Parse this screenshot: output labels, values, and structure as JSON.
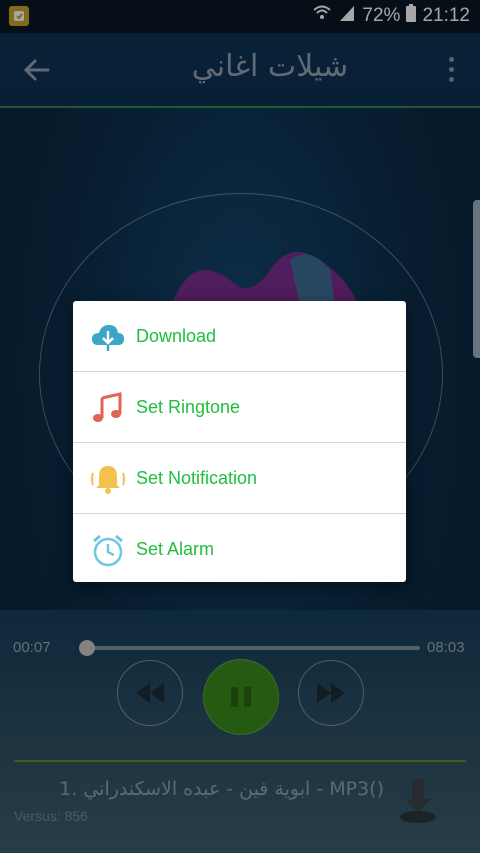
{
  "status_bar": {
    "battery": "72%",
    "time": "21:12"
  },
  "app_bar": {
    "title": "شيلات اغاني"
  },
  "player": {
    "elapsed": "00:07",
    "duration": "08:03",
    "progress": 0.015,
    "song_title": "1. ابوية فين - عبده الاسكندراني - MP3()",
    "version": "Versus: 856"
  },
  "dialog": {
    "items": [
      {
        "label": "Download",
        "icon": "cloud-download-icon"
      },
      {
        "label": "Set Ringtone",
        "icon": "music-note-icon"
      },
      {
        "label": "Set Notification",
        "icon": "bell-icon"
      },
      {
        "label": "Set Alarm",
        "icon": "alarm-clock-icon"
      }
    ]
  },
  "colors": {
    "accent_green": "#1fbf3f",
    "play_button": "#3a8a1e",
    "toolbar": "#0f3556"
  }
}
